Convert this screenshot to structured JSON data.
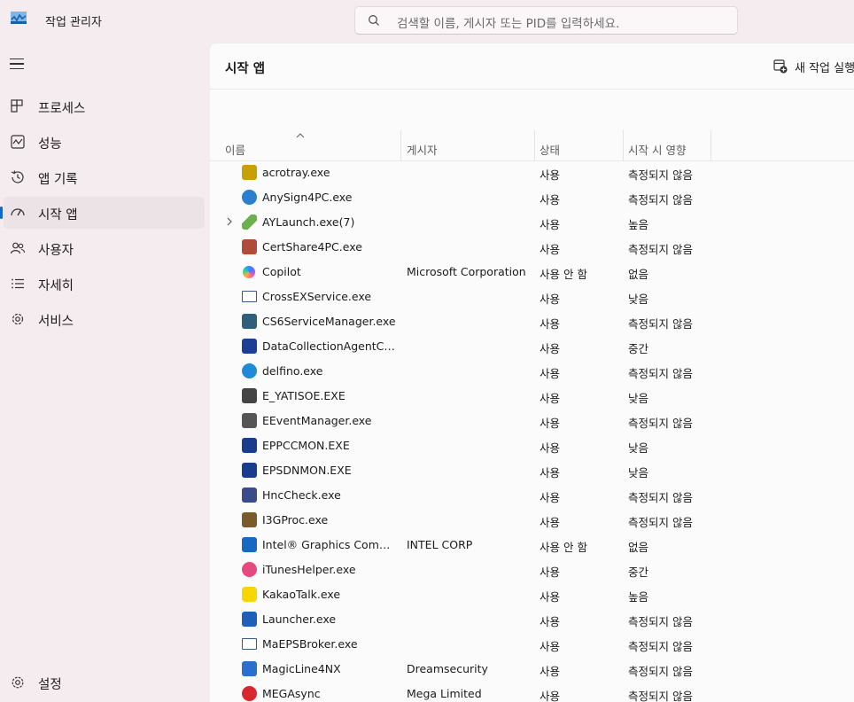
{
  "titlebar": {
    "app_title": "작업 관리자",
    "search_placeholder": "검색할 이름, 게시자 또는 PID를 입력하세요."
  },
  "sidebar": {
    "items": [
      {
        "label": "프로세스",
        "icon": "processes-icon"
      },
      {
        "label": "성능",
        "icon": "performance-icon"
      },
      {
        "label": "앱 기록",
        "icon": "app-history-icon"
      },
      {
        "label": "시작 앱",
        "icon": "startup-apps-icon",
        "active": true
      },
      {
        "label": "사용자",
        "icon": "users-icon"
      },
      {
        "label": "자세히",
        "icon": "details-icon"
      },
      {
        "label": "서비스",
        "icon": "services-icon"
      }
    ],
    "settings_label": "설정"
  },
  "main": {
    "title": "시작 앱",
    "run_task_label": "새 작업 실행",
    "columns": {
      "name": "이름",
      "publisher": "게시자",
      "status": "상태",
      "impact": "시작 시 영향"
    },
    "rows": [
      {
        "name": "acrotray.exe",
        "publisher": "",
        "status": "사용",
        "impact": "측정되지 않음",
        "icon_color": "#c8a000",
        "icon": "acrotray-icon"
      },
      {
        "name": "AnySign4PC.exe",
        "publisher": "",
        "status": "사용",
        "impact": "측정되지 않음",
        "icon_color": "#2a7fd0",
        "icon": "anysign-icon"
      },
      {
        "name": "AYLaunch.exe(7)",
        "publisher": "",
        "status": "사용",
        "impact": "높음",
        "icon_color": "#6ab04c",
        "icon": "aylaunch-icon",
        "expandable": true
      },
      {
        "name": "CertShare4PC.exe",
        "publisher": "",
        "status": "사용",
        "impact": "측정되지 않음",
        "icon_color": "#b04a3a",
        "icon": "certshare-icon"
      },
      {
        "name": "Copilot",
        "publisher": "Microsoft Corporation",
        "status": "사용 안 함",
        "impact": "없음",
        "icon_color": "#7b61ff",
        "icon": "copilot-icon"
      },
      {
        "name": "CrossEXService.exe",
        "publisher": "",
        "status": "사용",
        "impact": "낮음",
        "icon_color": "#3a5a8a",
        "icon": "window-icon"
      },
      {
        "name": "CS6ServiceManager.exe",
        "publisher": "",
        "status": "사용",
        "impact": "측정되지 않음",
        "icon_color": "#2f5e7a",
        "icon": "cs6-icon"
      },
      {
        "name": "DataCollectionAgentContr...",
        "publisher": "",
        "status": "사용",
        "impact": "중간",
        "icon_color": "#1c3f95",
        "icon": "datacollection-icon"
      },
      {
        "name": "delfino.exe",
        "publisher": "",
        "status": "사용",
        "impact": "측정되지 않음",
        "icon_color": "#1f8ad6",
        "icon": "delfino-icon"
      },
      {
        "name": "E_YATISOE.EXE",
        "publisher": "",
        "status": "사용",
        "impact": "낮음",
        "icon_color": "#444444",
        "icon": "printer-icon"
      },
      {
        "name": "EEventManager.exe",
        "publisher": "",
        "status": "사용",
        "impact": "측정되지 않음",
        "icon_color": "#555555",
        "icon": "scanner-icon"
      },
      {
        "name": "EPPCCMON.EXE",
        "publisher": "",
        "status": "사용",
        "impact": "낮음",
        "icon_color": "#1a3c8c",
        "icon": "eppccmon-icon"
      },
      {
        "name": "EPSDNMON.EXE",
        "publisher": "",
        "status": "사용",
        "impact": "낮음",
        "icon_color": "#1a3c8c",
        "icon": "epsdnmon-icon"
      },
      {
        "name": "HncCheck.exe",
        "publisher": "",
        "status": "사용",
        "impact": "측정되지 않음",
        "icon_color": "#3a4a8a",
        "icon": "hnccheck-icon"
      },
      {
        "name": "I3GProc.exe",
        "publisher": "",
        "status": "사용",
        "impact": "측정되지 않음",
        "icon_color": "#7a5a2a",
        "icon": "i3gproc-icon"
      },
      {
        "name": "Intel® Graphics Comman...",
        "publisher": "INTEL CORP",
        "status": "사용 안 함",
        "impact": "없음",
        "icon_color": "#1769c2",
        "icon": "intel-icon"
      },
      {
        "name": "iTunesHelper.exe",
        "publisher": "",
        "status": "사용",
        "impact": "중간",
        "icon_color": "#e64980",
        "icon": "itunes-icon"
      },
      {
        "name": "KakaoTalk.exe",
        "publisher": "",
        "status": "사용",
        "impact": "높음",
        "icon_color": "#f7d600",
        "icon": "kakaotalk-icon"
      },
      {
        "name": "Launcher.exe",
        "publisher": "",
        "status": "사용",
        "impact": "측정되지 않음",
        "icon_color": "#1f5fb8",
        "icon": "launcher-icon"
      },
      {
        "name": "MaEPSBroker.exe",
        "publisher": "",
        "status": "사용",
        "impact": "측정되지 않음",
        "icon_color": "#3a5a8a",
        "icon": "window-icon"
      },
      {
        "name": "MagicLine4NX",
        "publisher": "Dreamsecurity",
        "status": "사용",
        "impact": "측정되지 않음",
        "icon_color": "#2a6fd0",
        "icon": "magicline-icon"
      },
      {
        "name": "MEGAsync",
        "publisher": "Mega Limited",
        "status": "사용",
        "impact": "측정되지 않음",
        "icon_color": "#d9272e",
        "icon": "mega-icon"
      }
    ]
  }
}
